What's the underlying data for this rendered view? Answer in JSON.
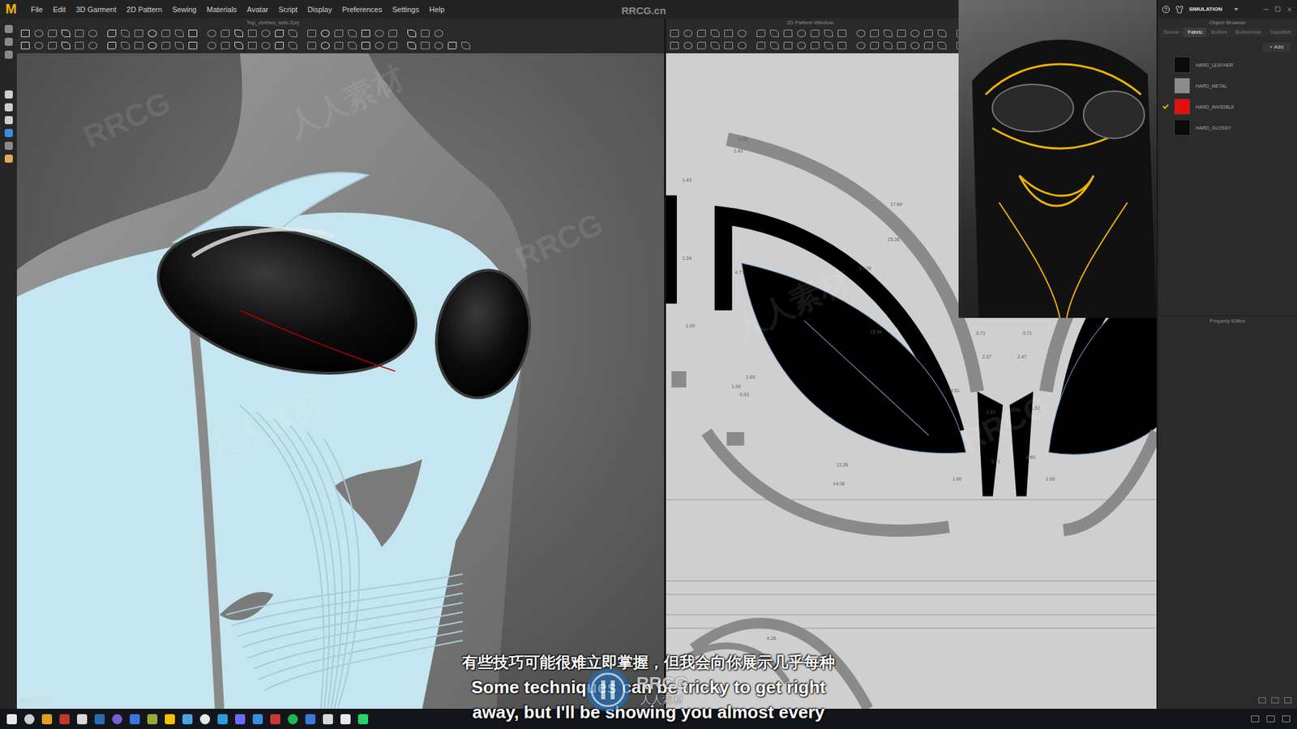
{
  "app": {
    "logo": "M",
    "watermark": "RRCG.cn"
  },
  "menu": [
    "File",
    "Edit",
    "3D Garment",
    "2D Pattern",
    "Sewing",
    "Materials",
    "Avatar",
    "Script",
    "Display",
    "Preferences",
    "Settings",
    "Help"
  ],
  "viewport3d": {
    "title": "Top_clothes_solo.Zprj"
  },
  "pattern2d": {
    "title": "2D Pattern Window",
    "measurements": [
      "0.78",
      "1.43",
      "17.64",
      "15.26",
      "1.43",
      "1.24",
      "17.29",
      "4.77",
      "15.34",
      "1.00",
      "1.69",
      "1.00",
      "0.93",
      "0.71",
      "0.71",
      "2.37",
      "2.47",
      "1.97",
      "1.52",
      "4.51",
      "3.71",
      "4.50",
      "12.26",
      "14.06",
      "1.00",
      "1.00",
      "4.26"
    ]
  },
  "right_panel": {
    "mode": "SIMULATION",
    "title": "Object Browser",
    "tabs": [
      {
        "label": "Scene",
        "selected": false
      },
      {
        "label": "Fabric",
        "selected": true
      },
      {
        "label": "Button",
        "selected": false
      },
      {
        "label": "Buttonhole",
        "selected": false
      },
      {
        "label": "Topstitch",
        "selected": false
      }
    ],
    "add_button": "+ Add",
    "fabrics": [
      {
        "name": "HARD_LEATHER",
        "checked": false,
        "color": "#0b0b0b"
      },
      {
        "name": "HARD_METAL",
        "checked": false,
        "color": "#8c8c8c"
      },
      {
        "name": "HARD_INVISIBLE",
        "checked": true,
        "color": "#e01010"
      },
      {
        "name": "HARD_GLOSSY",
        "checked": false,
        "color": "#0b0b0b"
      }
    ],
    "property_editor": "Property Editor"
  },
  "subtitles": [
    "有些技巧可能很难立即掌握，但我会向你展示几乎每种",
    "Some techniques can be tricky to get right",
    "away, but I'll be showing you almost every"
  ],
  "logo_overlay": {
    "top": "RRCG",
    "bottom": "人人素材"
  },
  "watermarks": [
    "RRCG",
    "人人素材",
    "RRCG",
    "人人素材",
    "RRCG",
    "人人素材",
    "RRCG"
  ]
}
